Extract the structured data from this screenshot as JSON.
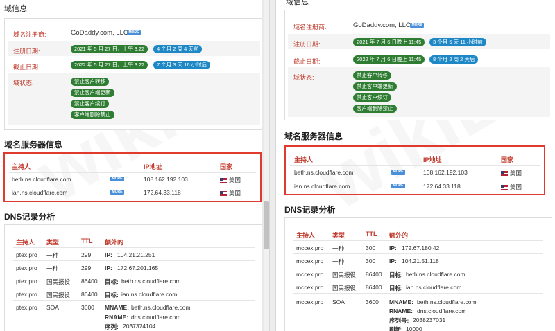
{
  "left": {
    "domain_info_title": "域信息",
    "registrar_label": "域名注册商:",
    "registrar_value": "GoDaddy.com, LLC",
    "more": "MORE",
    "reg_label": "注册日期:",
    "reg_date": "2021 年 5 月 27 日，上午 3:22",
    "reg_ago": "4 个月 2 周 4 天前",
    "exp_label": "截止日期:",
    "exp_date": "2022 年 5 月 27 日，上午 3:22",
    "exp_left": "7 个月 3 天 16 小时后",
    "status_label": "域状态:",
    "statuses": [
      "禁止客户转移",
      "禁止客户端更新",
      "禁止客户续订",
      "客户端删除禁止"
    ],
    "ns_title": "域名服务器信息",
    "ns_headers": [
      "主持人",
      "IP地址",
      "国家"
    ],
    "ns_rows": [
      {
        "host": "beth.ns.cloudflare.com",
        "ip": "108.162.192.103",
        "country": "美国"
      },
      {
        "host": "ian.ns.cloudflare.com",
        "ip": "172.64.33.118",
        "country": "美国"
      }
    ],
    "dns_title": "DNS记录分析",
    "dns_headers": [
      "主持人",
      "类型",
      "TTL",
      "额外的"
    ],
    "dns_rows": [
      {
        "host": "ptex.pro",
        "type": "一种",
        "ttl": "299",
        "k": "IP:",
        "v": "104.21.21.251"
      },
      {
        "host": "ptex.pro",
        "type": "一种",
        "ttl": "299",
        "k": "IP:",
        "v": "172.67.201.165"
      },
      {
        "host": "ptex.pro",
        "type": "国民报役",
        "ttl": "86400",
        "k": "目标:",
        "v": "beth.ns.cloudflare.com"
      },
      {
        "host": "ptex.pro",
        "type": "国民报役",
        "ttl": "86400",
        "k": "目标:",
        "v": "ian.ns.cloudflare.com"
      },
      {
        "host": "ptex.pro",
        "type": "SOA",
        "ttl": "3600",
        "k": "MNAME:",
        "v": "beth.ns.cloudflare.com"
      }
    ],
    "soa_extra": [
      {
        "k": "RNAME:",
        "v": "dns.cloudflare.com"
      },
      {
        "k": "序列:",
        "v": "2037374104"
      }
    ]
  },
  "right": {
    "domain_info_title": "域信息",
    "registrar_label": "域名注册商:",
    "registrar_value": "GoDaddy.com, LLC",
    "more": "MORE",
    "reg_label": "注册日期:",
    "reg_date": "2021 年 7 月 6 日晚上 11:45",
    "reg_ago": "3 个月 5 天 11 小时前",
    "exp_label": "截止日期:",
    "exp_date": "2022 年 7 月 6 日晚上 11:45",
    "exp_left": "8 个月 2 周 2 天后",
    "status_label": "域状态:",
    "statuses": [
      "禁止客户转移",
      "禁止客户端更新",
      "禁止客户续订",
      "客户端删除禁止"
    ],
    "ns_title": "域名服务器信息",
    "ns_headers": [
      "主持人",
      "IP地址",
      "国家"
    ],
    "ns_rows": [
      {
        "host": "beth.ns.cloudflare.com",
        "ip": "108.162.192.103",
        "country": "美国"
      },
      {
        "host": "ian.ns.cloudflare.com",
        "ip": "172.64.33.118",
        "country": "美国"
      }
    ],
    "dns_title": "DNS记录分析",
    "dns_headers": [
      "主持人",
      "类型",
      "TTL",
      "额外的"
    ],
    "dns_rows": [
      {
        "host": "mccex.pro",
        "type": "一种",
        "ttl": "300",
        "k": "IP:",
        "v": "172.67.180.42"
      },
      {
        "host": "mccex.pro",
        "type": "一种",
        "ttl": "300",
        "k": "IP:",
        "v": "104.21.51.118"
      },
      {
        "host": "mccex.pro",
        "type": "国民报役",
        "ttl": "86400",
        "k": "目标:",
        "v": "beth.ns.cloudflare.com"
      },
      {
        "host": "mccex.pro",
        "type": "国民报役",
        "ttl": "86400",
        "k": "目标:",
        "v": "ian.ns.cloudflare.com"
      },
      {
        "host": "mccex.pro",
        "type": "SOA",
        "ttl": "3600",
        "k": "MNAME:",
        "v": "beth.ns.cloudflare.com"
      }
    ],
    "soa_extra": [
      {
        "k": "RNAME:",
        "v": "dns.cloudflare.com"
      },
      {
        "k": "序列号:",
        "v": "2038237031"
      },
      {
        "k": "刷新:",
        "v": "10000"
      }
    ]
  },
  "watermark": "wikiBit"
}
